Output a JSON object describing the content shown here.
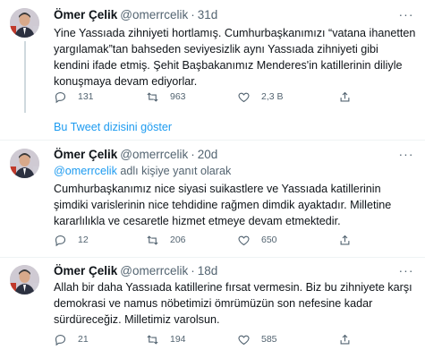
{
  "tweets": [
    {
      "name": "Ömer Çelik",
      "handle": "@omerrcelik",
      "time": "31d",
      "text": "Yine Yassıada zihniyeti hortlamış. Cumhurbaşkanımızı “vatana ihanetten yargılamak”tan bahseden seviyesizlik aynı Yassıada zihniyeti gibi kendini ifade etmiş. Şehit Başbakanımız Menderes'in katillerinin diliyle konuşmaya devam ediyorlar.",
      "replies": "131",
      "retweets": "963",
      "likes": "2,3 B"
    },
    {
      "name": "Ömer Çelik",
      "handle": "@omerrcelik",
      "time": "20d",
      "replying_mention": "@omerrcelik",
      "replying_suffix": " adlı kişiye yanıt olarak",
      "text": "Cumhurbaşkanımız nice siyasi suikastlere ve Yassıada katillerinin şimdiki varislerinin nice tehdidine rağmen dimdik ayaktadır. Milletine kararlılıkla ve cesaretle hizmet etmeye devam etmektedir.",
      "replies": "12",
      "retweets": "206",
      "likes": "650"
    },
    {
      "name": "Ömer Çelik",
      "handle": "@omerrcelik",
      "time": "18d",
      "text": "Allah bir daha Yassıada katillerine fırsat vermesin. Biz bu zihniyete karşı demokrasi ve namus nöbetimizi ömrümüzün son nefesine kadar sürdüreceğiz. Milletimiz varolsun.",
      "replies": "21",
      "retweets": "194",
      "likes": "585"
    }
  ],
  "show_thread_label": "Bu Tweet dizisini göster",
  "icons": {
    "reply": "reply-icon",
    "retweet": "retweet-icon",
    "like": "heart-icon",
    "share": "share-icon",
    "more": "more-icon"
  },
  "colors": {
    "text": "#0f1419",
    "secondary": "#536471",
    "link": "#1d9bf0",
    "divider": "#eff3f4"
  }
}
